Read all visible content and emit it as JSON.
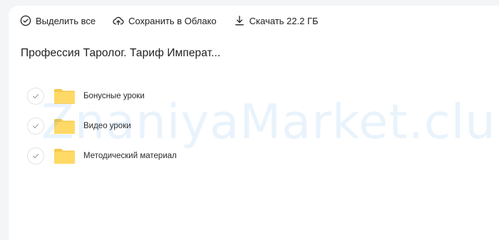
{
  "toolbar": {
    "select_all_label": "Выделить все",
    "save_cloud_label": "Сохранить в Облако",
    "download_label": "Скачать 22.2 ГБ"
  },
  "folder": {
    "title": "Профессия Таролог. Тариф Императ..."
  },
  "files": [
    {
      "name": "Бонусные уроки",
      "type": "folder",
      "icon": "folder-icon"
    },
    {
      "name": "Видео уроки",
      "type": "folder",
      "icon": "folder-icon"
    },
    {
      "name": "Методический материал",
      "type": "folder",
      "icon": "folder-icon"
    }
  ],
  "watermark": "ZnaniyaMarket.club",
  "colors": {
    "folder": "#ffd966",
    "folder_tab": "#f5c94c",
    "text": "#222222",
    "watermark": "#2f8fe8"
  }
}
